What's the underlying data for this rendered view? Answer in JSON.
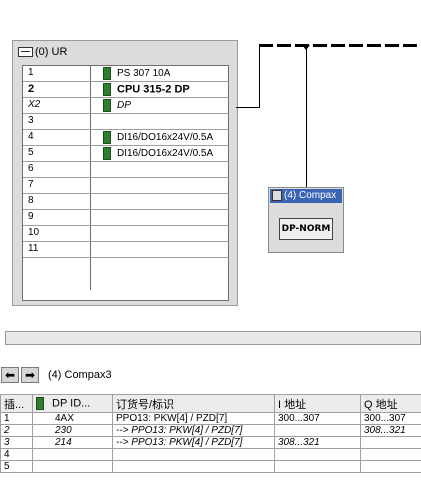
{
  "rack": {
    "title": "(0) UR",
    "slots": [
      {
        "num": "1",
        "module": "PS 307 10A"
      },
      {
        "num": "2",
        "module": "CPU 315-2 DP"
      },
      {
        "num": "X2",
        "module": "DP"
      },
      {
        "num": "3",
        "module": ""
      },
      {
        "num": "4",
        "module": "DI16/DO16x24V/0.5A"
      },
      {
        "num": "5",
        "module": "DI16/DO16x24V/0.5A"
      },
      {
        "num": "6",
        "module": ""
      },
      {
        "num": "7",
        "module": ""
      },
      {
        "num": "8",
        "module": ""
      },
      {
        "num": "9",
        "module": ""
      },
      {
        "num": "10",
        "module": ""
      },
      {
        "num": "11",
        "module": ""
      }
    ]
  },
  "node": {
    "title": "(4) Compax",
    "label": "DP-NORM"
  },
  "nav": {
    "label": "(4)   Compax3"
  },
  "table": {
    "headers": [
      "插...",
      "DP ID...",
      "订货号/标识",
      "I 地址",
      "Q 地址"
    ],
    "rows": [
      [
        "1",
        "4AX",
        "PPO13:  PKW[4] / PZD[7]",
        "300...307",
        "300...307"
      ],
      [
        "2",
        "230",
        "--> PPO13:  PKW[4] / PZD[7]",
        "",
        "308...321"
      ],
      [
        "3",
        "214",
        "--> PPO13:  PKW[4] / PZD[7]",
        "308...321",
        ""
      ],
      [
        "4",
        "",
        "",
        "",
        ""
      ],
      [
        "5",
        "",
        "",
        "",
        ""
      ]
    ]
  }
}
